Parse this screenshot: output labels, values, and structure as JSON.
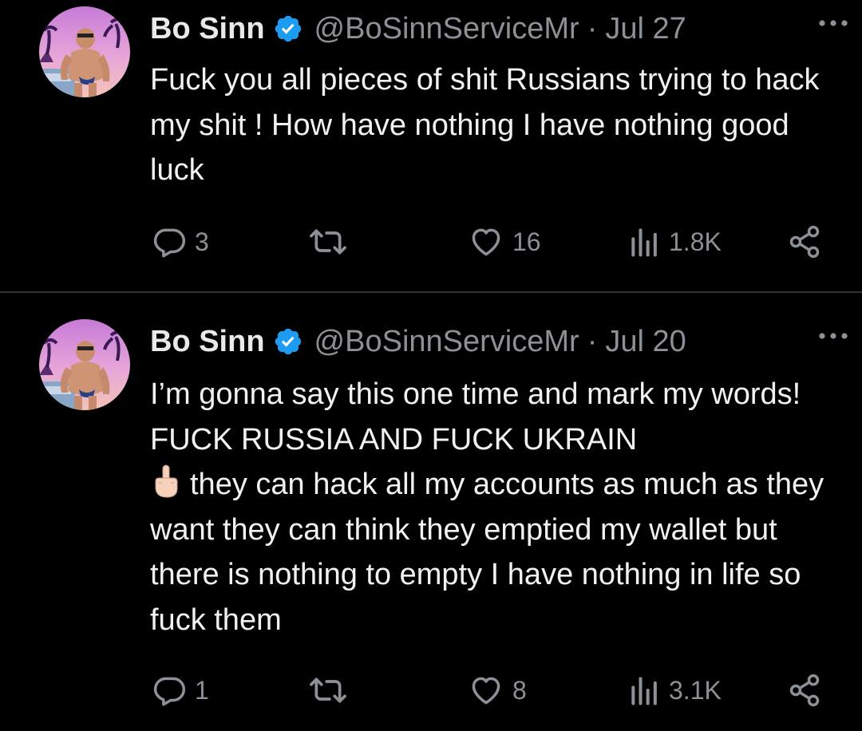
{
  "colors": {
    "background": "#000000",
    "text_primary": "#e7e9ea",
    "text_secondary": "#8b9197",
    "verified_badge": "#1d9bf0",
    "divider": "#2f3336"
  },
  "tweets": [
    {
      "author_name": "Bo Sinn",
      "verified_icon": "verified-badge-icon",
      "handle": "@BoSinnServiceMr",
      "separator": "·",
      "date": "Jul 27",
      "more_icon": "more-dots-icon",
      "text": "Fuck you all pieces of shit Russians trying to hack my shit ! How have nothing I have nothing good luck",
      "replies": "3",
      "retweets": "",
      "likes": "16",
      "views": "1.8K"
    },
    {
      "author_name": "Bo Sinn",
      "verified_icon": "verified-badge-icon",
      "handle": "@BoSinnServiceMr",
      "separator": "·",
      "date": "Jul 20",
      "more_icon": "more-dots-icon",
      "text_line1": "I’m gonna say this one time and mark my words! FUCK RUSSIA AND FUCK UKRAIN",
      "emoji": "middle-finger-emoji",
      "text_line2": "they can hack all my accounts as much as they want they can think they emptied my wallet but there is nothing to empty I have nothing in life so fuck them",
      "replies": "1",
      "retweets": "",
      "likes": "8",
      "views": "3.1K"
    }
  ]
}
